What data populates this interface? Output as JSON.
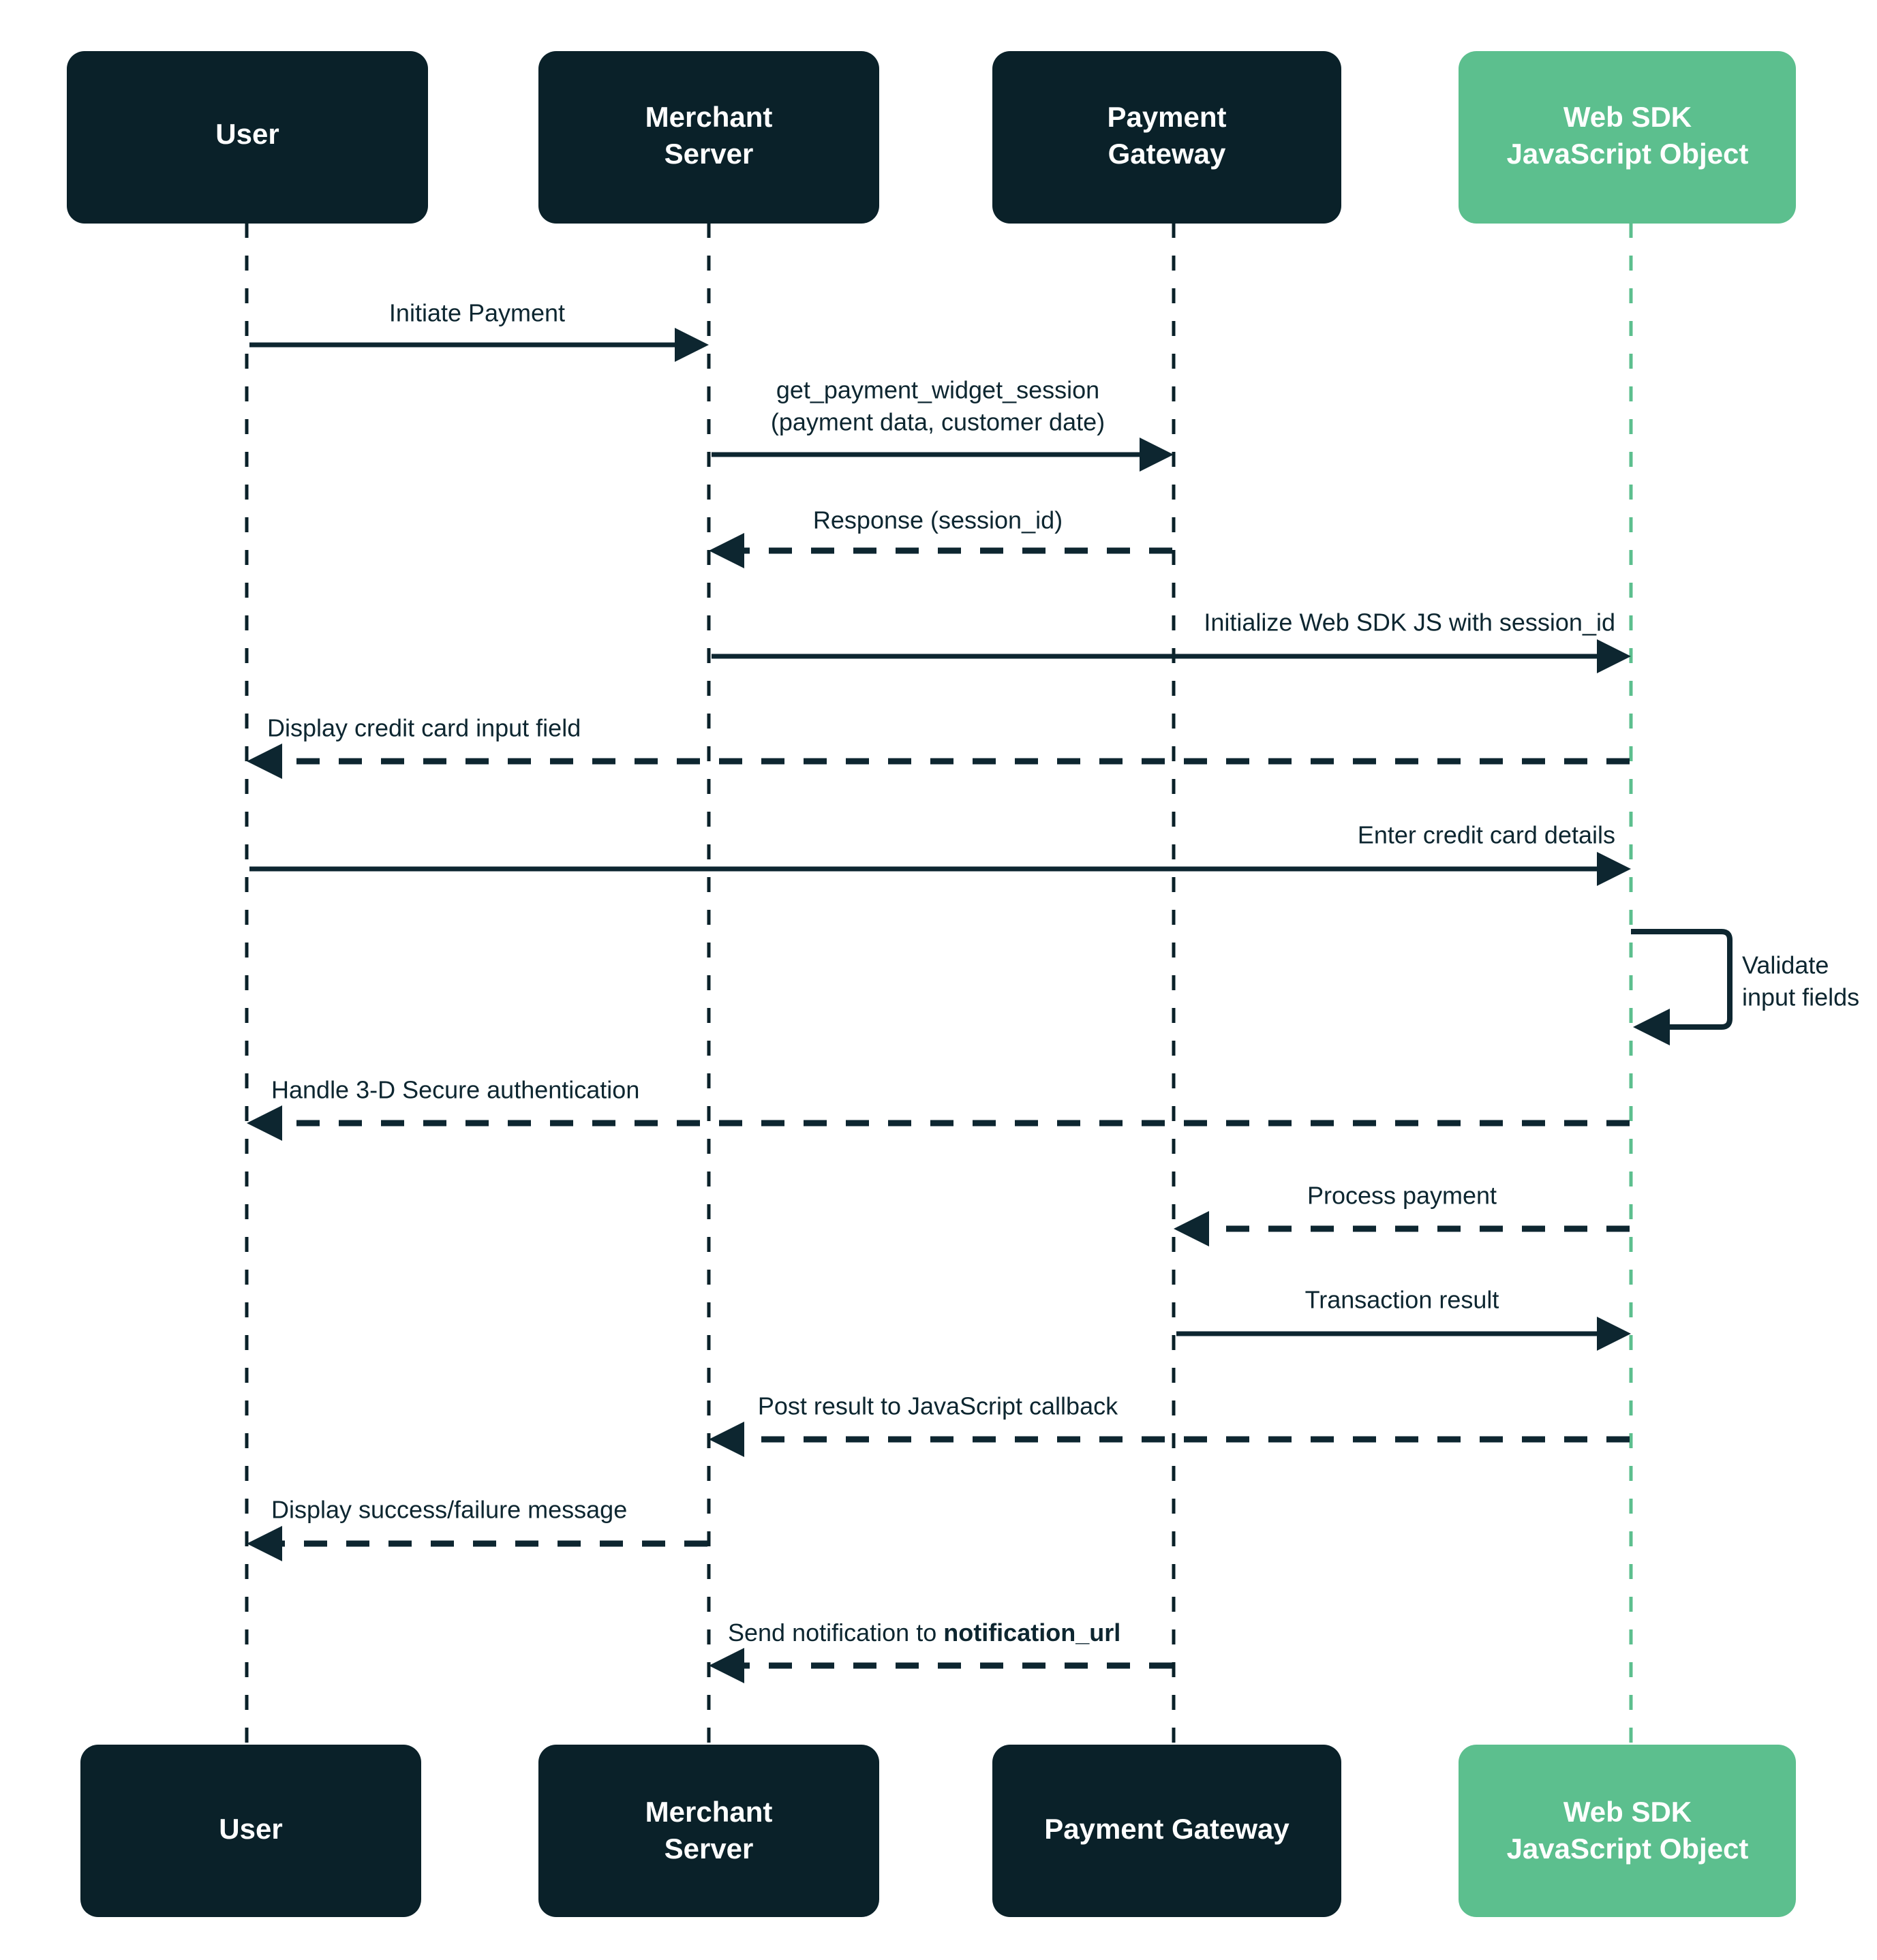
{
  "diagram": {
    "title": "Web SDK payment sequence diagram",
    "type": "sequence-diagram",
    "colors": {
      "actor_dark": "#0a2129",
      "actor_accent": "#5cbf8e",
      "line": "#0d2630",
      "label_text": "#0d2630",
      "actor_text": "#ffffff",
      "background": "#ffffff"
    },
    "actors": [
      {
        "id": "user",
        "header_label": "User",
        "header_lines": [
          "User"
        ],
        "footer_label": "User",
        "footer_lines": [
          "User"
        ],
        "color": "#0a2129",
        "lifeline_color": "#0a2129"
      },
      {
        "id": "merchant_server",
        "header_label": "Merchant Server",
        "header_lines": [
          "Merchant",
          "Server"
        ],
        "footer_label": "Merchant Server",
        "footer_lines": [
          "Merchant",
          "Server"
        ],
        "color": "#0a2129",
        "lifeline_color": "#0a2129"
      },
      {
        "id": "payment_gateway",
        "header_label": "Payment Gateway",
        "header_lines": [
          "Payment",
          "Gateway"
        ],
        "footer_label": "Payment Gateway",
        "footer_lines": [
          "Payment Gateway"
        ],
        "color": "#0a2129",
        "lifeline_color": "#0a2129"
      },
      {
        "id": "web_sdk",
        "header_label": "Web SDK JavaScript Object",
        "header_lines": [
          "Web SDK",
          "JavaScript Object"
        ],
        "footer_label": "Web SDK JavaScript Object",
        "footer_lines": [
          "Web SDK",
          "JavaScript Object"
        ],
        "color": "#5cbf8e",
        "lifeline_color": "#5cbf8e"
      }
    ],
    "messages": [
      {
        "index": 1,
        "label": "Initiate Payment",
        "label_lines": [
          "Initiate Payment"
        ],
        "from": "user",
        "to": "merchant_server",
        "style": "solid",
        "direction": "right"
      },
      {
        "index": 2,
        "label": "get_payment_widget_session (payment data, customer date)",
        "label_lines": [
          "get_payment_widget_session",
          "(payment data, customer date)"
        ],
        "from": "merchant_server",
        "to": "payment_gateway",
        "style": "solid",
        "direction": "right"
      },
      {
        "index": 3,
        "label": "Response (session_id)",
        "label_lines": [
          "Response (session_id)"
        ],
        "from": "payment_gateway",
        "to": "merchant_server",
        "style": "dashed",
        "direction": "left"
      },
      {
        "index": 4,
        "label": "Initialize Web SDK JS with session_id",
        "label_lines": [
          "Initialize Web SDK JS with session_id"
        ],
        "from": "merchant_server",
        "to": "web_sdk",
        "style": "solid",
        "direction": "right"
      },
      {
        "index": 5,
        "label": "Display credit card input field",
        "label_lines": [
          "Display credit card input field"
        ],
        "from": "web_sdk",
        "to": "user",
        "style": "dashed",
        "direction": "left"
      },
      {
        "index": 6,
        "label": "Enter credit card details",
        "label_lines": [
          "Enter credit card details"
        ],
        "from": "user",
        "to": "web_sdk",
        "style": "solid",
        "direction": "right"
      },
      {
        "index": 7,
        "label": "Validate input fields",
        "label_lines": [
          "Validate",
          "input fields"
        ],
        "from": "web_sdk",
        "to": "web_sdk",
        "style": "self-loop",
        "direction": "self"
      },
      {
        "index": 8,
        "label": "Handle 3-D Secure authentication",
        "label_lines": [
          "Handle 3-D Secure authentication"
        ],
        "from": "web_sdk",
        "to": "user",
        "style": "dashed",
        "direction": "left"
      },
      {
        "index": 9,
        "label": "Process payment",
        "label_lines": [
          "Process payment"
        ],
        "from": "web_sdk",
        "to": "payment_gateway",
        "style": "dashed",
        "direction": "left"
      },
      {
        "index": 10,
        "label": "Transaction result",
        "label_lines": [
          "Transaction result"
        ],
        "from": "payment_gateway",
        "to": "web_sdk",
        "style": "solid",
        "direction": "right"
      },
      {
        "index": 11,
        "label": "Post result to JavaScript callback",
        "label_lines": [
          "Post result to JavaScript callback"
        ],
        "from": "web_sdk",
        "to": "merchant_server",
        "style": "dashed",
        "direction": "left"
      },
      {
        "index": 12,
        "label": "Display success/failure message",
        "label_lines": [
          "Display success/failure message"
        ],
        "from": "merchant_server",
        "to": "user",
        "style": "dashed",
        "direction": "left"
      },
      {
        "index": 13,
        "label": "Send notification to notification_url",
        "label_prefix": "Send notification to ",
        "label_bold": "notification_url",
        "label_lines": [
          "Send notification to notification_url"
        ],
        "from": "payment_gateway",
        "to": "merchant_server",
        "style": "dashed",
        "direction": "left"
      }
    ]
  }
}
